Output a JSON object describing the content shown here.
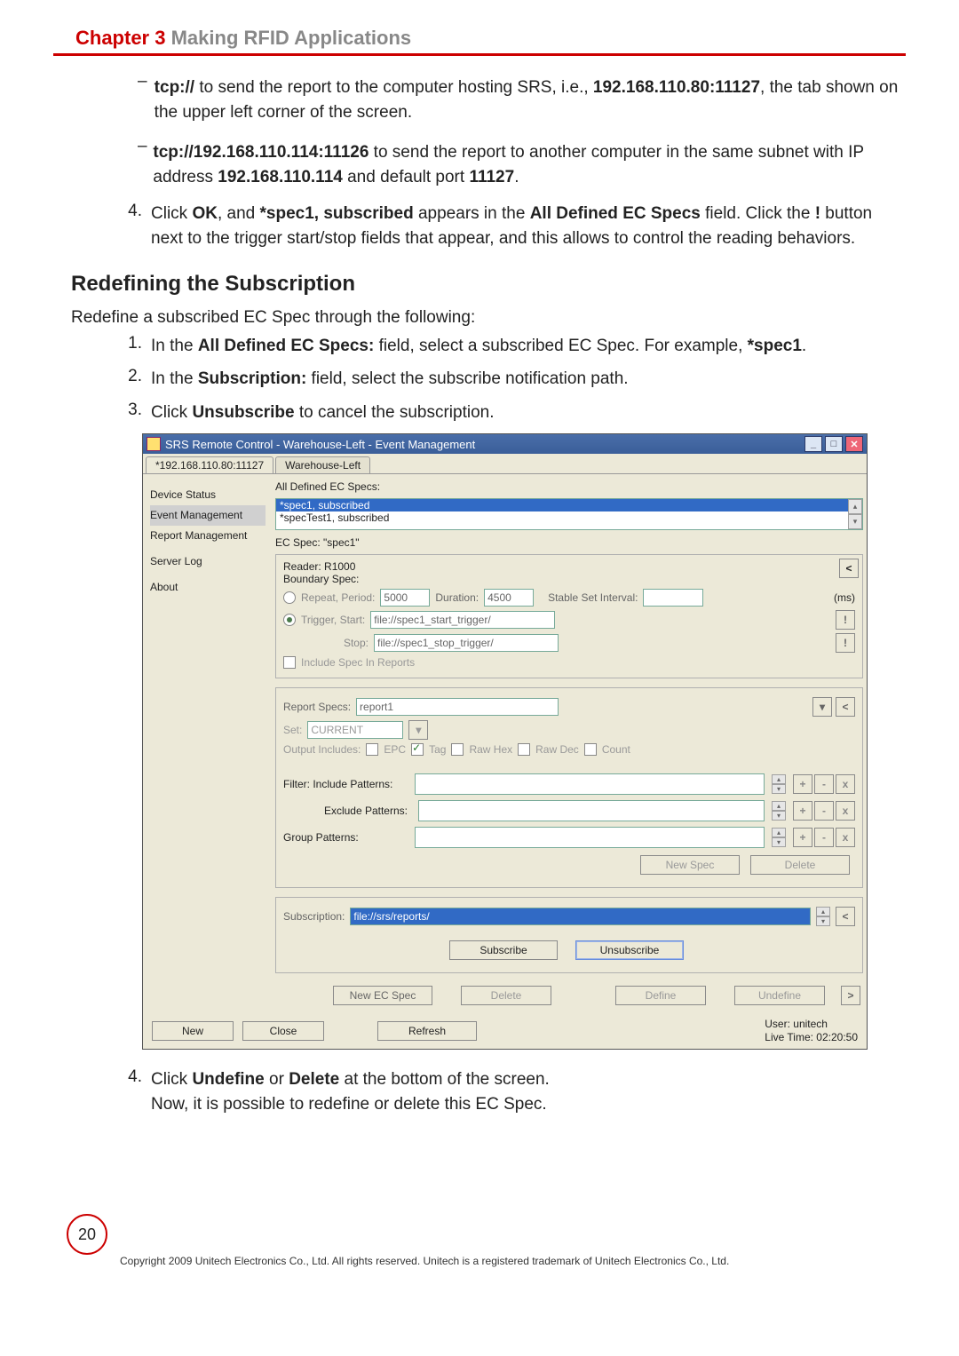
{
  "chapter": {
    "red": "Chapter 3",
    "gray": "  Making RFID Applications"
  },
  "bullets": [
    {
      "prefix": "tcp://",
      "rest1": " to send the report to the computer hosting SRS, i.e., ",
      "bold1": "192.168.110.80:11127",
      "rest2": ", the tab shown on the upper left corner of the screen."
    },
    {
      "prefix": "tcp://192.168.110.114:11126",
      "rest1": " to send the report to another computer in the same subnet with IP address ",
      "bold1": "192.168.110.114",
      "rest2": " and default port ",
      "bold2": "11127",
      "tail": "."
    }
  ],
  "step4_top": {
    "num": "4.",
    "t1": "Click ",
    "b1": "OK",
    "t2": ", and ",
    "b2": "*spec1, subscribed",
    "t3": " appears in the ",
    "b3": "All Defined EC Specs",
    "t4": " field. Click the ",
    "b4": "!",
    "t5": " button next to the trigger start/stop fields that appear, and this allows to control the reading behaviors."
  },
  "section_title": "Redefining the Subscription",
  "section_intro": "Redefine a subscribed EC Spec through the following:",
  "steps": [
    {
      "num": "1.",
      "t1": "In the ",
      "b1": "All Defined EC Specs:",
      "t2": " field, select a subscribed EC Spec. For example, ",
      "b2": "*spec1",
      "t3": "."
    },
    {
      "num": "2.",
      "t1": "In the ",
      "b1": "Subscription:",
      "t2": " field, select the subscribe notification path."
    },
    {
      "num": "3.",
      "t1": "Click ",
      "b1": "Unsubscribe",
      "t2": " to cancel the subscription."
    }
  ],
  "step4_bottom": {
    "num": "4.",
    "t1": "Click ",
    "b1": "Undefine",
    "t2": " or ",
    "b2": "Delete",
    "t3": " at the bottom of the screen.",
    "line2": "Now, it is possible to redefine or delete this EC Spec."
  },
  "page_number": "20",
  "copyright": "Copyright 2009 Unitech Electronics Co., Ltd. All rights reserved. Unitech is a registered trademark of Unitech Electronics Co., Ltd.",
  "win": {
    "title": "SRS Remote Control - Warehouse-Left - Event Management",
    "controls": {
      "min": "_",
      "max": "□",
      "close": "✕"
    },
    "tabs": [
      "*192.168.110.80:11127",
      "Warehouse-Left"
    ],
    "sidebar": [
      "Device Status",
      "Event Management",
      "Report Management",
      "Server Log",
      "About"
    ],
    "sidebar_gap_after": [
      2,
      3
    ],
    "labels": {
      "all_defined": "All Defined EC Specs:",
      "ec_spec": "EC Spec: \"spec1\"",
      "reader": "Reader: R1000",
      "boundary": "Boundary Spec:",
      "repeat": "Repeat, Period:",
      "duration": "Duration:",
      "stable": "Stable Set Interval:",
      "ms": "(ms)",
      "trigger_start": "Trigger, Start:",
      "stop": "Stop:",
      "include_spec": "Include Spec In Reports",
      "report_specs": "Report Specs:",
      "set": "Set:",
      "output_includes": "Output Includes:",
      "filter_include": "Filter: Include Patterns:",
      "exclude": "Exclude Patterns:",
      "group": "Group Patterns:",
      "subscription": "Subscription:"
    },
    "values": {
      "period": "5000",
      "duration": "4500",
      "stable": "",
      "start_trigger": "file://spec1_start_trigger/",
      "stop_trigger": "file://spec1_stop_trigger/",
      "report_spec": "report1",
      "set": "CURRENT",
      "subscription": "file://srs/reports/"
    },
    "listbox": [
      "*spec1, subscribed",
      "*specTest1, subscribed"
    ],
    "checkboxes": {
      "epc": "EPC",
      "tag": "Tag",
      "rawhex": "Raw Hex",
      "rawdec": "Raw Dec",
      "count": "Count"
    },
    "buttons": {
      "bang": "!",
      "lt": "<",
      "gt": ">",
      "plus": "+",
      "minus": "-",
      "x": "x",
      "new_spec": "New Spec",
      "delete": "Delete",
      "subscribe": "Subscribe",
      "unsubscribe": "Unsubscribe",
      "new_ec": "New EC Spec",
      "define": "Define",
      "undefine": "Undefine",
      "new": "New",
      "close": "Close",
      "refresh": "Refresh"
    },
    "user_box": {
      "line1": "User: unitech",
      "line2": "Live Time: 02:20:50"
    }
  }
}
